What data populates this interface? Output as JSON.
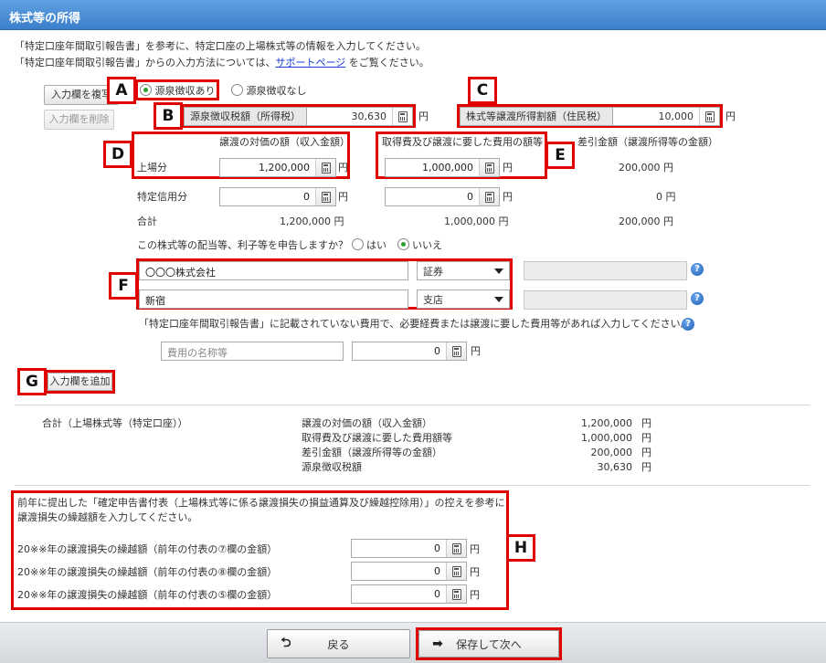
{
  "window": {
    "title": "株式等の所得"
  },
  "intro": {
    "line1": "「特定口座年間取引報告書」を参考に、特定口座の上場株式等の情報を入力してください。",
    "line2_pre": "「特定口座年間取引報告書」からの入力方法については、",
    "line2_link": "サポートページ",
    "line2_post": "をご覧ください。"
  },
  "buttons": {
    "copy_field": "入力欄を複写",
    "delete_field": "入力欄を削除",
    "add_field": "入力欄を追加",
    "back": "戻る",
    "save_next": "保存して次へ"
  },
  "withholding": {
    "with_label": "源泉徴収あり",
    "without_label": "源泉徴収なし",
    "selected": "源泉徴収あり"
  },
  "tax": {
    "withholding_label": "源泉徴収税額（所得税）",
    "withholding_value": "30,630",
    "resident_label": "株式等譲渡所得割額（住民税）",
    "resident_value": "10,000",
    "unit": "円"
  },
  "table": {
    "col_income": "譲渡の対価の額（収入金額）",
    "col_cost": "取得費及び譲渡に要した費用の額等",
    "col_diff": "差引金額（譲渡所得等の金額）",
    "rows": [
      {
        "label": "上場分",
        "income": "1,200,000",
        "cost": "1,000,000",
        "diff": "200,000 円"
      },
      {
        "label": "特定信用分",
        "income": "0",
        "cost": "0",
        "diff": "0 円"
      }
    ],
    "total": {
      "label": "合計",
      "income": "1,200,000 円",
      "cost": "1,000,000 円",
      "diff": "200,000 円"
    },
    "unit": "円"
  },
  "dividend": {
    "question": "この株式等の配当等、利子等を申告しますか？",
    "yes": "はい",
    "no": "いいえ",
    "selected": "いいえ"
  },
  "broker": {
    "company": "〇〇〇株式会社",
    "company_type": "証券",
    "branch": "新宿",
    "branch_type": "支店"
  },
  "expense": {
    "note": "「特定口座年間取引報告書」に記載されていない費用で、必要経費または譲渡に要した費用等があれば入力してください。",
    "name_placeholder": "費用の名称等",
    "amount": "0",
    "unit": "円"
  },
  "summary": {
    "title": "合計（上場株式等（特定口座））",
    "items": [
      {
        "label": "譲渡の対価の額（収入金額）",
        "value": "1,200,000",
        "unit": "円"
      },
      {
        "label": "取得費及び譲渡に要した費用額等",
        "value": "1,000,000",
        "unit": "円"
      },
      {
        "label": "差引金額（譲渡所得等の金額）",
        "value": "200,000",
        "unit": "円"
      },
      {
        "label": "源泉徴収税額",
        "value": "30,630",
        "unit": "円"
      }
    ]
  },
  "carryover": {
    "note1": "前年に提出した「確定申告書付表（上場株式等に係る譲渡損失の損益通算及び繰越控除用）」の控えを参考に",
    "note2": "譲渡損失の繰越額を入力してください。",
    "rows": [
      {
        "label": "20※※年の譲渡損失の繰越額（前年の付表の⑦欄の金額）",
        "value": "0"
      },
      {
        "label": "20※※年の譲渡損失の繰越額（前年の付表の⑧欄の金額）",
        "value": "0"
      },
      {
        "label": "20※※年の譲渡損失の繰越額（前年の付表の⑤欄の金額）",
        "value": "0"
      }
    ],
    "unit": "円"
  },
  "markers": [
    "A",
    "B",
    "C",
    "D",
    "E",
    "F",
    "G",
    "H"
  ],
  "colors": {
    "titlebar": "#3b7fcc",
    "highlight": "#e00000",
    "link": "#1a3fd6",
    "radio_on": "#2aa02a"
  }
}
